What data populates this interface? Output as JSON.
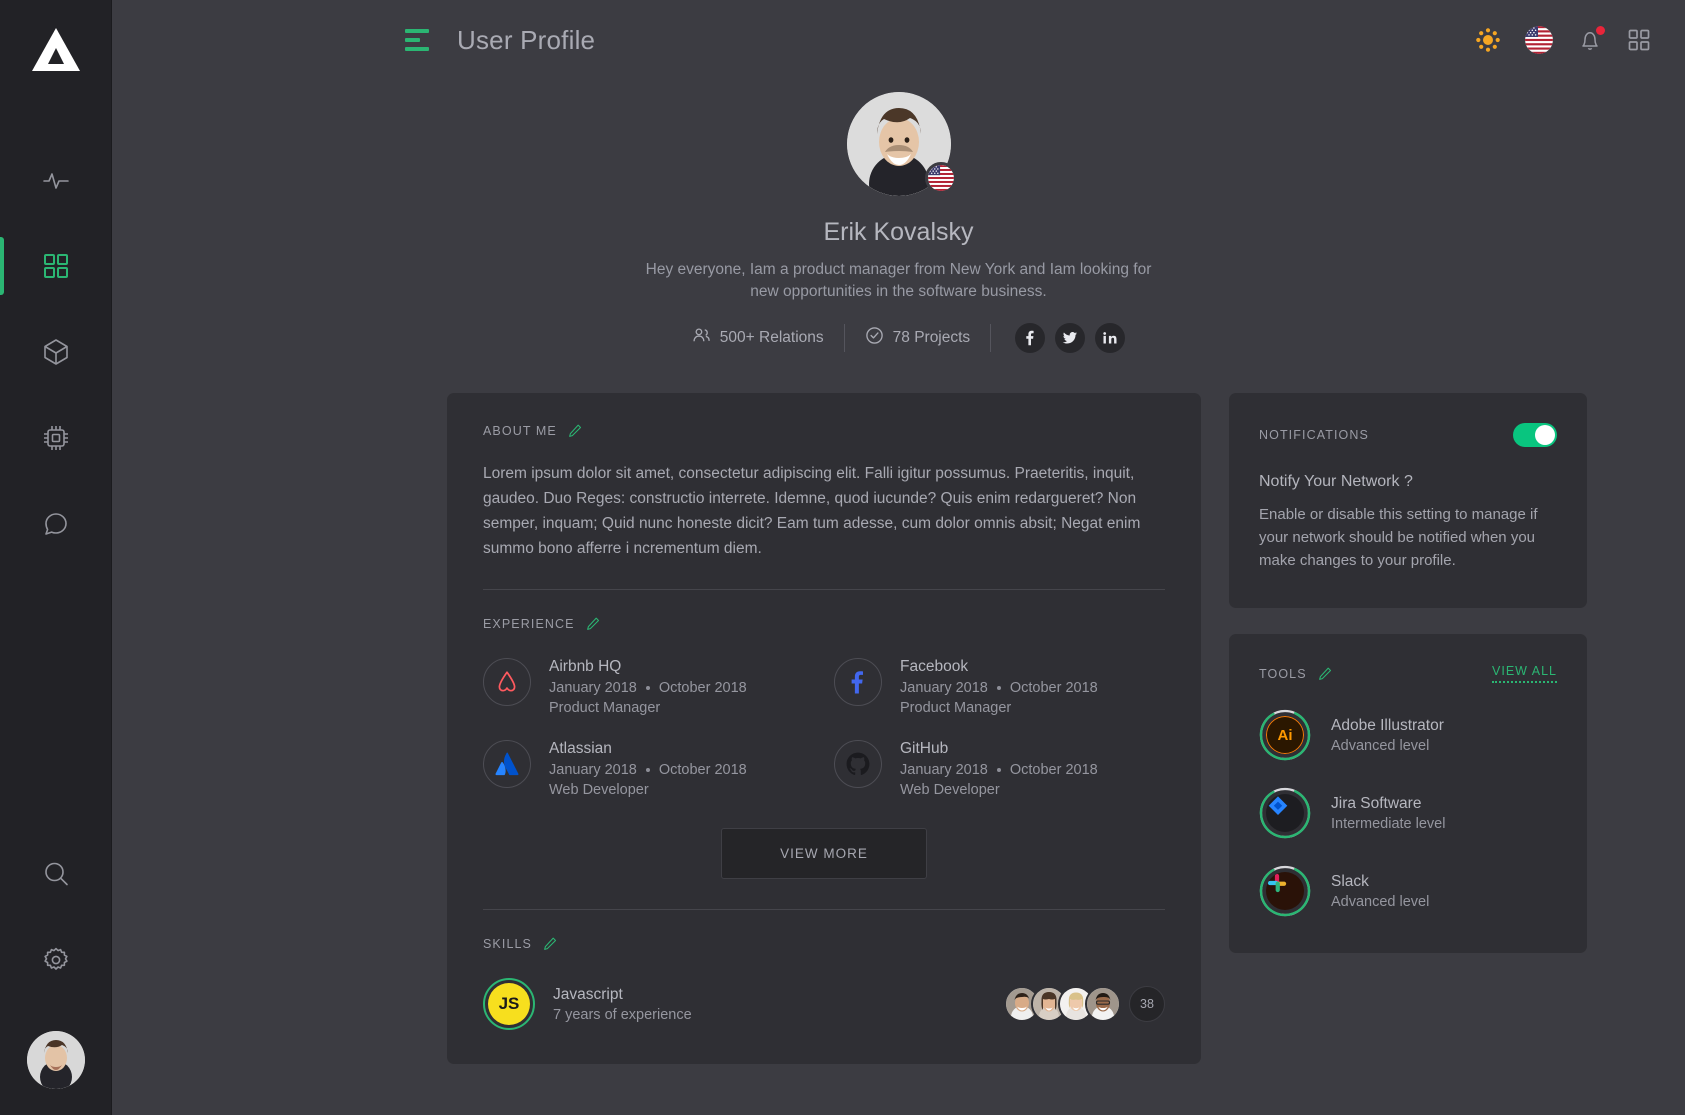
{
  "sidebar": {
    "logo_name": "triangle-logo",
    "items": [
      {
        "icon": "activity-pulse-icon",
        "name": "analytics",
        "active": false
      },
      {
        "icon": "grid-dashboard-icon",
        "name": "dashboard",
        "active": true
      },
      {
        "icon": "cube-box-icon",
        "name": "products",
        "active": false
      },
      {
        "icon": "cpu-chip-icon",
        "name": "devices",
        "active": false
      },
      {
        "icon": "chat-bubble-icon",
        "name": "messages",
        "active": false
      }
    ],
    "bottom_items": [
      {
        "icon": "search-icon",
        "name": "search"
      },
      {
        "icon": "gear-settings-icon",
        "name": "settings"
      }
    ],
    "avatar_name": "user-avatar"
  },
  "topbar": {
    "menu_icon": "hamburger-menu-icon",
    "title": "User Profile",
    "icons": [
      {
        "name": "brightness-sun-icon"
      },
      {
        "name": "us-flag-icon"
      },
      {
        "name": "notification-bell-icon",
        "has_badge": true
      },
      {
        "name": "apps-grid-icon"
      }
    ]
  },
  "profile": {
    "avatar_name": "profile-avatar",
    "flag_name": "us-flag-badge",
    "name": "Erik Kovalsky",
    "bio": "Hey everyone,  Iam a product manager from New York and Iam looking for new opportunities in the software business.",
    "stats": [
      {
        "icon": "people-icon",
        "label": "500+ Relations"
      },
      {
        "icon": "check-circle-icon",
        "label": "78 Projects"
      }
    ],
    "socials": [
      {
        "name": "facebook-icon",
        "glyph": "f"
      },
      {
        "name": "twitter-icon",
        "glyph": "t"
      },
      {
        "name": "linkedin-icon",
        "glyph": "in"
      }
    ]
  },
  "about": {
    "title": "ABOUT ME",
    "edit_icon": "pencil-edit-icon",
    "text": "Lorem ipsum dolor sit amet, consectetur adipiscing elit. Falli igitur possumus. Praeteritis, inquit, gaudeo. Duo Reges: constructio interrete. Idemne, quod iucunde? Quis enim redargueret? Non semper, inquam; Quid nunc honeste dicit? Eam tum adesse, cum dolor omnis absit; Negat enim summo bono afferre i ncrementum diem."
  },
  "experience": {
    "title": "EXPERIENCE",
    "edit_icon": "pencil-edit-icon",
    "items": [
      {
        "logo": "airbnb-icon",
        "company": "Airbnb HQ",
        "start": "January 2018",
        "end": "October 2018",
        "role": "Product Manager"
      },
      {
        "logo": "facebook-icon",
        "company": "Facebook",
        "start": "January 2018",
        "end": "October 2018",
        "role": "Product Manager"
      },
      {
        "logo": "atlassian-icon",
        "company": "Atlassian",
        "start": "January 2018",
        "end": "October 2018",
        "role": "Web Developer"
      },
      {
        "logo": "github-icon",
        "company": "GitHub",
        "start": "January 2018",
        "end": "October 2018",
        "role": "Web Developer"
      }
    ],
    "view_more_label": "VIEW MORE"
  },
  "skills": {
    "title": "SKILLS",
    "edit_icon": "pencil-edit-icon",
    "items": [
      {
        "badge": "javascript-icon",
        "badge_text": "JS",
        "name": "Javascript",
        "sub": "7 years of experience",
        "people_count_label": "38"
      }
    ]
  },
  "notifications": {
    "title": "NOTIFICATIONS",
    "toggle_name": "notifications-toggle",
    "toggle_on": true,
    "question": "Notify Your Network ?",
    "description": "Enable or disable this setting to manage if your network should be notified when you make changes to your profile."
  },
  "tools": {
    "title": "TOOLS",
    "edit_icon": "pencil-edit-icon",
    "view_all_label": "VIEW ALL",
    "items": [
      {
        "icon": "adobe-illustrator-icon",
        "name": "Adobe Illustrator",
        "level": "Advanced level",
        "progress": 85
      },
      {
        "icon": "jira-software-icon",
        "name": "Jira Software",
        "level": "Intermediate level",
        "progress": 85
      },
      {
        "icon": "slack-icon",
        "name": "Slack",
        "level": "Advanced level",
        "progress": 85
      }
    ]
  },
  "colors": {
    "page_bg": "#3c3c42",
    "sidebar_bg": "#222226",
    "card_bg": "#2f2f34",
    "accent_green": "#2bb673",
    "toggle_green": "#09c57f",
    "badge_red": "#e8253a",
    "sun_yellow": "#f5a623",
    "js_yellow": "#f7df1e"
  }
}
